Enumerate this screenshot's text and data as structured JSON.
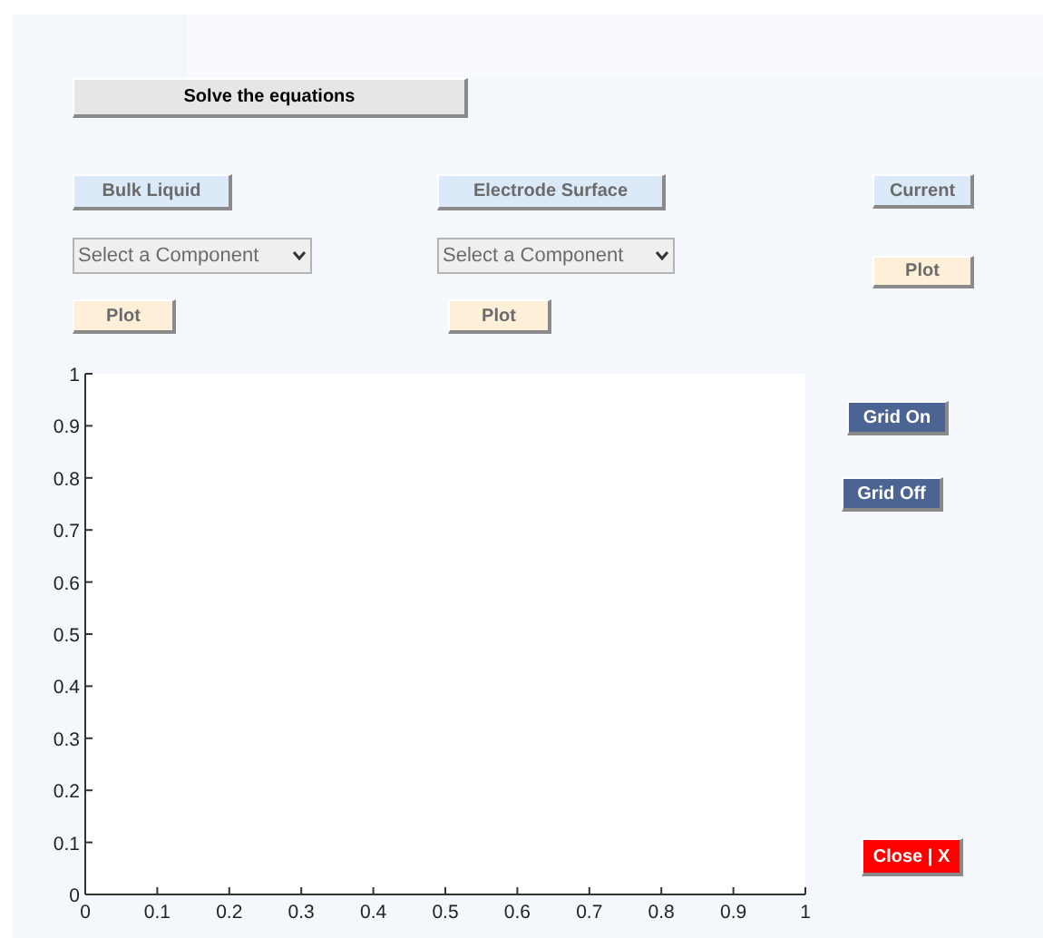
{
  "solve_button": {
    "label": "Solve the equations"
  },
  "columns": [
    {
      "kind": "section",
      "header": "Bulk Liquid",
      "select": {
        "value": "Select a Component"
      },
      "plot_button": "Plot"
    },
    {
      "kind": "section",
      "header": "Electrode Surface",
      "select": {
        "value": "Select a Component"
      },
      "plot_button": "Plot"
    },
    {
      "kind": "current",
      "header": "Current",
      "plot_button": "Plot"
    }
  ],
  "plot": {
    "chart_data": {
      "type": "line",
      "xlim": [
        0,
        1
      ],
      "ylim": [
        0,
        1
      ],
      "xticks": [
        0,
        0.1,
        0.2,
        0.3,
        0.4,
        0.5,
        0.6,
        0.7,
        0.8,
        0.9,
        1
      ],
      "yticks": [
        0,
        0.1,
        0.2,
        0.3,
        0.4,
        0.5,
        0.6,
        0.7,
        0.8,
        0.9,
        1
      ]
    }
  },
  "grid_buttons": [
    "Grid On",
    "Grid Off"
  ],
  "close_button": "Close | X"
}
